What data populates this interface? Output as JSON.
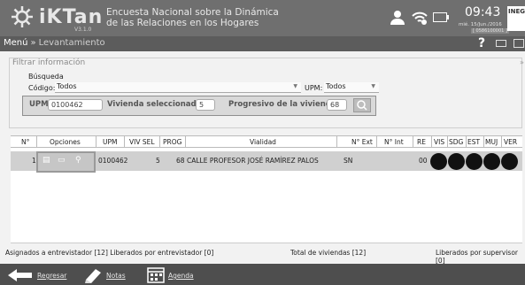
{
  "header": {
    "logo": "iKTan",
    "version": "V3.1.0",
    "survey_title_line1": "Encuesta Nacional sobre la Dinámica",
    "survey_title_line2": "de las Relaciones en los Hogares",
    "time": "09:43",
    "date": "mié. 15/Jun./2016",
    "device_code": "[ 0586100001 ]",
    "badge": "INEG"
  },
  "nav": {
    "menu": "Menú",
    "separator": "»",
    "current": "Levantamiento",
    "help": "?"
  },
  "filter": {
    "title": "Filtrar información",
    "collapse": "»",
    "busqueda": "Búsqueda",
    "codigo_label": "Código:",
    "codigo_value": "Todos",
    "upm_top_label": "UPM:",
    "upm_top_value": "Todos",
    "upm_label": "UPM:",
    "upm_value": "0100462",
    "vivienda_label": "Vivienda seleccionada:",
    "vivienda_value": "5",
    "progresivo_label": "Progresivo de la vivienda:",
    "progresivo_value": "68"
  },
  "table": {
    "headers": [
      "N°",
      "Opciones",
      "UPM",
      "VIV SEL",
      "PROG",
      "Vialidad",
      "N° Ext",
      "N° Int",
      "RE",
      "VIS",
      "SDG",
      "EST",
      "MUJ",
      "VER"
    ],
    "row": {
      "n": "1",
      "upm": "0100462",
      "viv_sel": "5",
      "prog": "68",
      "vialidad": "CALLE PROFESOR JOSÉ RAMÍREZ PALOS",
      "n_ext": "SN",
      "n_int": "",
      "re": "00"
    }
  },
  "stats": {
    "asignados": "Asignados a entrevistador [12] Liberados por entrevistador [0]",
    "total": "Total de viviendas [12]",
    "liberados_supervisor": "Liberados por supervisor [0]"
  },
  "bottom": {
    "regresar": "Regresar",
    "notas": "Notas",
    "agenda": "Agenda"
  }
}
